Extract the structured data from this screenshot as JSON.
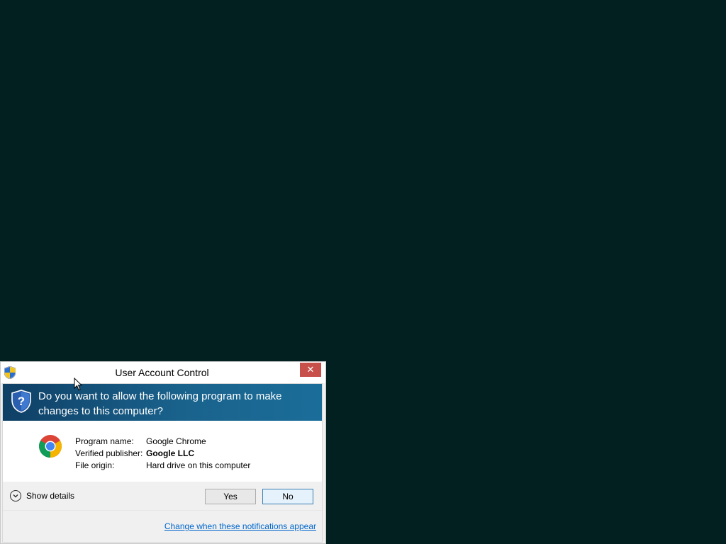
{
  "window": {
    "title": "User Account Control",
    "close_glyph": "✕"
  },
  "banner": {
    "question": "Do you want to allow the following program to make changes to this computer?",
    "icon": "shield-question-icon"
  },
  "program": {
    "icon": "chrome-icon",
    "rows": [
      {
        "label": "Program name:",
        "value": "Google Chrome"
      },
      {
        "label": "Verified publisher:",
        "value": "Google LLC"
      },
      {
        "label": "File origin:",
        "value": "Hard drive on this computer"
      }
    ]
  },
  "details": {
    "label": "Show details"
  },
  "buttons": {
    "yes": "Yes",
    "no": "No"
  },
  "footer": {
    "link": "Change when these notifications appear"
  },
  "colors": {
    "desktop": "#022020",
    "banner": "#19628c",
    "close": "#c7504b",
    "link": "#0066cc"
  }
}
